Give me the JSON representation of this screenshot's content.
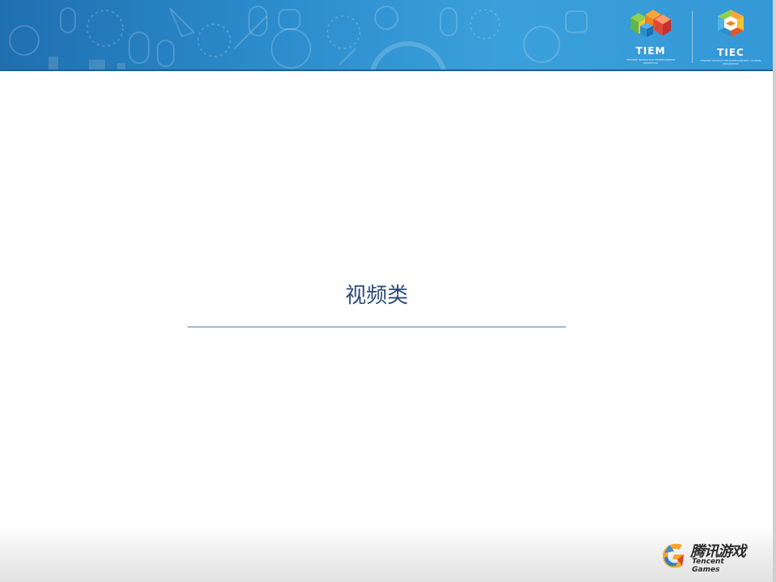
{
  "header": {
    "logos": [
      {
        "label": "TIEM",
        "subtitle": "TENCENT INTERACTIVE ENTERTAINMENT MARKETING",
        "icon": "tiem-cube-logo-icon"
      },
      {
        "label": "TIEC",
        "subtitle": "TENCENT INTERACTIVE ENTERTAINMENT CHANNEL DEPARTMENT",
        "icon": "tiec-hexagon-logo-icon"
      }
    ],
    "colors": {
      "banner_start": "#1f6fb0",
      "banner_end": "#3498d6"
    }
  },
  "main": {
    "title": "视频类",
    "title_color": "#2a4a78",
    "rule_color": "#4a7fb5"
  },
  "footer": {
    "brand_cn": "腾讯游戏",
    "brand_en": "Tencent Games",
    "icon": "tencent-games-logo-icon"
  }
}
